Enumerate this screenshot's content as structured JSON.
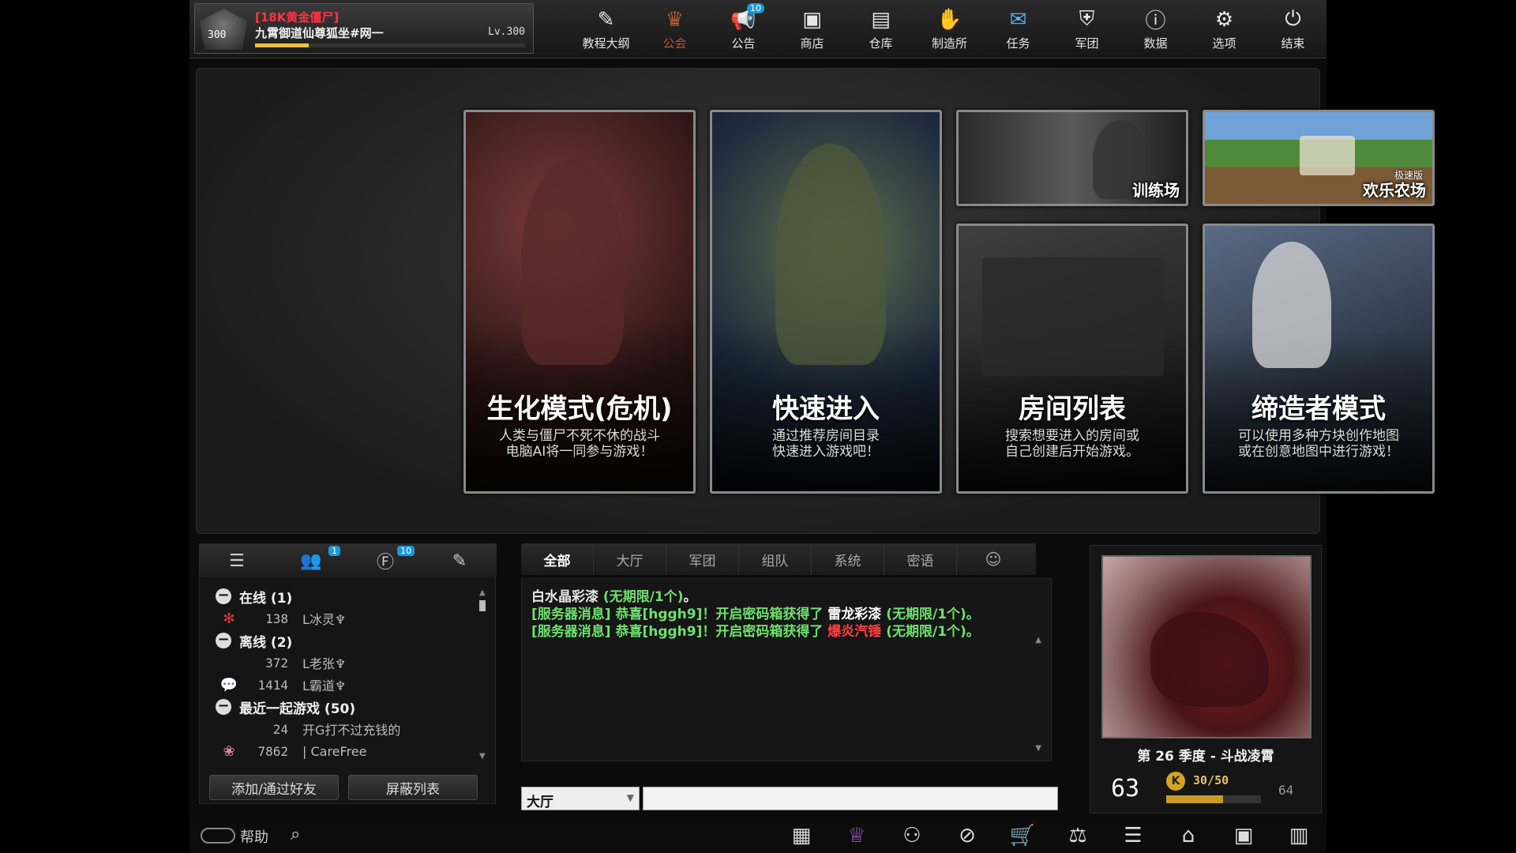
{
  "profile": {
    "rank": "300",
    "clan": "[18K黄金僵尸]",
    "nickname": "九霄御道仙尊狐坐#网一",
    "level": "Lv.300",
    "exp_fraction": 0.2
  },
  "nav": [
    {
      "label": "教程大纲",
      "icon": "tutorial-icon",
      "glyph": "✎"
    },
    {
      "label": "公会",
      "icon": "crown-icon",
      "glyph": "♛"
    },
    {
      "label": "公告",
      "icon": "megaphone-icon",
      "glyph": "📢",
      "badge": "10"
    },
    {
      "label": "商店",
      "icon": "shop-icon",
      "glyph": "▣"
    },
    {
      "label": "仓库",
      "icon": "inventory-icon",
      "glyph": "▤"
    },
    {
      "label": "制造所",
      "icon": "workshop-icon",
      "glyph": "✋"
    },
    {
      "label": "任务",
      "icon": "mission-icon",
      "glyph": "✉"
    },
    {
      "label": "军团",
      "icon": "clan-shield-icon",
      "glyph": "⛨"
    },
    {
      "label": "数据",
      "icon": "stats-icon",
      "glyph": "ⓘ"
    },
    {
      "label": "选项",
      "icon": "gear-icon",
      "glyph": "⚙"
    },
    {
      "label": "结束",
      "icon": "power-icon",
      "glyph": "⏻"
    }
  ],
  "cards": {
    "zombie": {
      "title": "生化模式(危机)",
      "desc1": "人类与僵尸不死不休的战斗",
      "desc2": "电脑AI将一同参与游戏！"
    },
    "quick": {
      "title": "快速进入",
      "desc1": "通过推荐房间目录",
      "desc2": "快速进入游戏吧！"
    },
    "rooms": {
      "title": "房间列表",
      "desc1": "搜索想要进入的房间或",
      "desc2": "自己创建后开始游戏。"
    },
    "maker": {
      "title": "缔造者模式",
      "desc1": "可以使用多种方块创作地图",
      "desc2": "或在创意地图中进行游戏！"
    },
    "train": {
      "label": "训练场"
    },
    "farm": {
      "label": "欢乐农场",
      "sub": "极速版"
    }
  },
  "friends": {
    "tabs": [
      {
        "icon": "friend-list-icon",
        "glyph": "☰"
      },
      {
        "icon": "friends-icon",
        "glyph": "👥",
        "badge": "1"
      },
      {
        "icon": "clan-members-icon",
        "glyph": "Ⓕ",
        "badge": "10"
      },
      {
        "icon": "edit-icon",
        "glyph": "✎"
      }
    ],
    "online_group": "在线  (1)",
    "offline_group": "离线  (2)",
    "recent_group": "最近一起游戏  (50)",
    "online": [
      {
        "lvl": "138",
        "name": "L冰灵♆"
      }
    ],
    "offline": [
      {
        "lvl": "372",
        "name": "L老张♆"
      },
      {
        "lvl": "1414",
        "name": "L霸道♆"
      }
    ],
    "recent": [
      {
        "lvl": "24",
        "name": "开G打不过充钱的"
      },
      {
        "lvl": "7862",
        "name": "| CareFree"
      }
    ],
    "add_button": "添加/通过好友",
    "block_button": "屏蔽列表"
  },
  "chat": {
    "tabs": [
      "全部",
      "大厅",
      "军团",
      "组队",
      "系统",
      "密语"
    ],
    "line1_a": "白水晶彩漆 ",
    "line1_b": "(无期限/1个)",
    "line1_c": "。",
    "line2_a": "[服务器消息] 恭喜[hggh9]！开启密码箱获得了 ",
    "line2_b": "雷龙彩漆",
    "line2_c": " (无期限/1个)。",
    "line3_a": "[服务器消息] 恭喜[hggh9]！开启密码箱获得了 ",
    "line3_b": "爆炎汽锤",
    "line3_c": " (无期限/1个)。",
    "channel": "大厅",
    "input_value": ""
  },
  "season": {
    "title": "第 26 季度 - 斗战凌霄",
    "level": "63",
    "xp": "30/50",
    "xp_fraction": 0.6,
    "next": "64"
  },
  "bottom": {
    "help": "帮助",
    "shortcuts": [
      {
        "icon": "calendar-icon",
        "glyph": "▦"
      },
      {
        "icon": "crown-w-icon",
        "glyph": "♕",
        "purple": true
      },
      {
        "icon": "runner-icon",
        "glyph": "⚇"
      },
      {
        "icon": "compass-icon",
        "glyph": "⊘"
      },
      {
        "icon": "cart-icon",
        "glyph": "🛒"
      },
      {
        "icon": "balance-icon",
        "glyph": "⚖"
      },
      {
        "icon": "list-icon",
        "glyph": "☰"
      },
      {
        "icon": "home-icon",
        "glyph": "⌂"
      },
      {
        "icon": "checkin-icon",
        "glyph": "▣"
      },
      {
        "icon": "film-icon",
        "glyph": "▥"
      }
    ]
  }
}
